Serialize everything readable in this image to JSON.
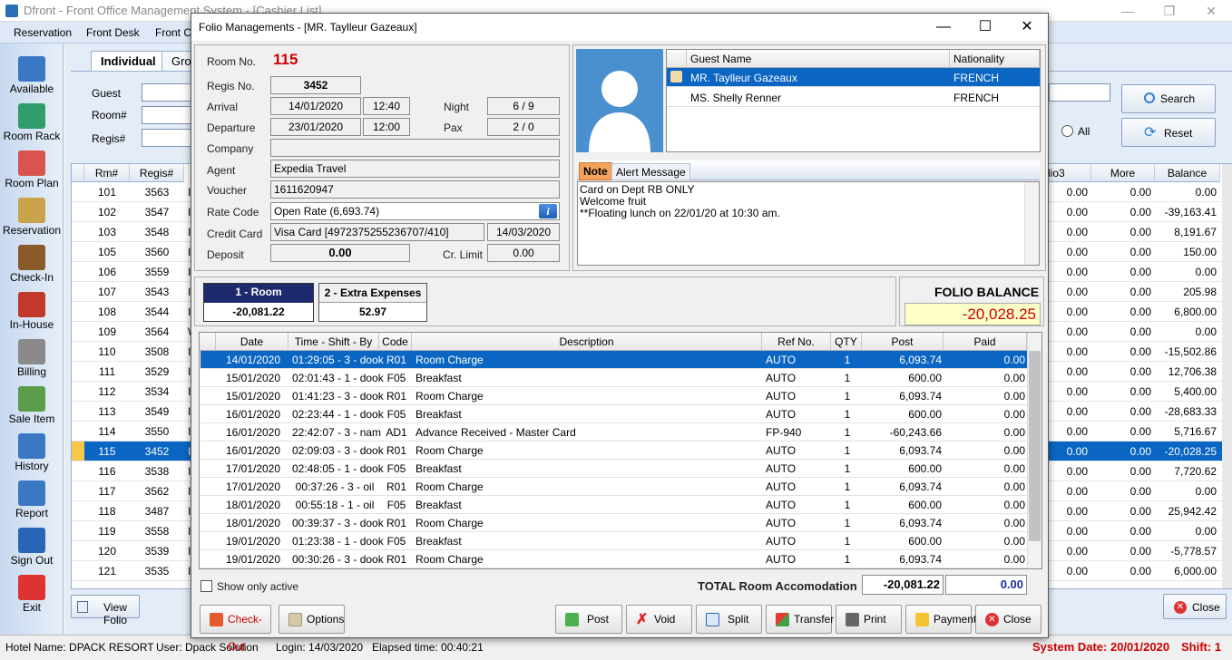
{
  "main_window": {
    "title": "Dfront - Front Office Management System - [Cashier List]",
    "menu": [
      "Reservation",
      "Front Desk",
      "Front C"
    ]
  },
  "sidebar": [
    {
      "label": "Available",
      "icon": "calendar-icon"
    },
    {
      "label": "Room Rack",
      "icon": "room-rack-icon"
    },
    {
      "label": "Room Plan",
      "icon": "room-plan-icon"
    },
    {
      "label": "Reservation",
      "icon": "book-icon"
    },
    {
      "label": "Check-In",
      "icon": "luggage-icon"
    },
    {
      "label": "In-House",
      "icon": "house-icon"
    },
    {
      "label": "Billing",
      "icon": "cash-register-icon"
    },
    {
      "label": "Sale Item",
      "icon": "bottles-icon"
    },
    {
      "label": "History",
      "icon": "history-icon"
    },
    {
      "label": "Report",
      "icon": "report-icon"
    },
    {
      "label": "Sign Out",
      "icon": "sign-out-icon"
    },
    {
      "label": "Exit",
      "icon": "power-icon"
    }
  ],
  "background": {
    "tabs": [
      "Individual",
      "Grou"
    ],
    "labels": {
      "guest": "Guest",
      "room": "Room#",
      "regis": "Regis#"
    },
    "search_button": "Search",
    "reset_button": "Reset",
    "all_radio": "All",
    "view_folio_button": "View Folio",
    "close_button": "Close",
    "grid_headers_left": [
      "Rm#",
      "Regis#"
    ],
    "grid_headers_right": [
      "lio3",
      "More",
      "Balance"
    ],
    "rows": [
      {
        "rm": "101",
        "regis": "3563",
        "c": "I",
        "lio3": "0.00",
        "more": "0.00",
        "balance": "0.00"
      },
      {
        "rm": "102",
        "regis": "3547",
        "c": "I",
        "lio3": "0.00",
        "more": "0.00",
        "balance": "-39,163.41"
      },
      {
        "rm": "103",
        "regis": "3548",
        "c": "I",
        "lio3": "0.00",
        "more": "0.00",
        "balance": "8,191.67"
      },
      {
        "rm": "105",
        "regis": "3560",
        "c": "I",
        "lio3": "0.00",
        "more": "0.00",
        "balance": "150.00"
      },
      {
        "rm": "106",
        "regis": "3559",
        "c": "I",
        "lio3": "0.00",
        "more": "0.00",
        "balance": "0.00"
      },
      {
        "rm": "107",
        "regis": "3543",
        "c": "I",
        "lio3": "0.00",
        "more": "0.00",
        "balance": "205.98"
      },
      {
        "rm": "108",
        "regis": "3544",
        "c": "I",
        "lio3": "0.00",
        "more": "0.00",
        "balance": "6,800.00"
      },
      {
        "rm": "109",
        "regis": "3564",
        "c": "W",
        "lio3": "0.00",
        "more": "0.00",
        "balance": "0.00"
      },
      {
        "rm": "110",
        "regis": "3508",
        "c": "I",
        "lio3": "0.00",
        "more": "0.00",
        "balance": "-15,502.86"
      },
      {
        "rm": "111",
        "regis": "3529",
        "c": "I",
        "lio3": "0.00",
        "more": "0.00",
        "balance": "12,706.38"
      },
      {
        "rm": "112",
        "regis": "3534",
        "c": "I",
        "lio3": "0.00",
        "more": "0.00",
        "balance": "5,400.00"
      },
      {
        "rm": "113",
        "regis": "3549",
        "c": "I",
        "lio3": "0.00",
        "more": "0.00",
        "balance": "-28,683.33"
      },
      {
        "rm": "114",
        "regis": "3550",
        "c": "I",
        "lio3": "0.00",
        "more": "0.00",
        "balance": "5,716.67"
      },
      {
        "rm": "115",
        "regis": "3452",
        "c": "I",
        "lio3": "0.00",
        "more": "0.00",
        "balance": "-20,028.25",
        "selected": true
      },
      {
        "rm": "116",
        "regis": "3538",
        "c": "I",
        "lio3": "0.00",
        "more": "0.00",
        "balance": "7,720.62"
      },
      {
        "rm": "117",
        "regis": "3562",
        "c": "I",
        "lio3": "0.00",
        "more": "0.00",
        "balance": "0.00"
      },
      {
        "rm": "118",
        "regis": "3487",
        "c": "I",
        "lio3": "0.00",
        "more": "0.00",
        "balance": "25,942.42"
      },
      {
        "rm": "119",
        "regis": "3558",
        "c": "IN",
        "lio3": "0.00",
        "more": "0.00",
        "balance": "0.00"
      },
      {
        "rm": "120",
        "regis": "3539",
        "c": "I",
        "lio3": "0.00",
        "more": "0.00",
        "balance": "-5,778.57"
      },
      {
        "rm": "121",
        "regis": "3535",
        "c": "I",
        "lio3": "0.00",
        "more": "0.00",
        "balance": "6,000.00"
      }
    ]
  },
  "status_bar": {
    "hotel": "Hotel Name: DPACK RESORT",
    "user": "User: Dpack Solution",
    "login": "Login: 14/03/2020",
    "elapsed": "Elapsed time: 00:40:21",
    "system_date": "System Date: 20/01/2020",
    "shift": "Shift: 1"
  },
  "dialog": {
    "title": "Folio Managements - [MR. Taylleur Gazeaux]",
    "labels": {
      "room_no": "Room No.",
      "regis_no": "Regis No.",
      "arrival": "Arrival",
      "departure": "Departure",
      "night": "Night",
      "pax": "Pax",
      "company": "Company",
      "agent": "Agent",
      "voucher": "Voucher",
      "rate_code": "Rate Code",
      "credit_card": "Credit Card",
      "deposit": "Deposit",
      "cr_limit": "Cr. Limit"
    },
    "values": {
      "room_no": "115",
      "regis_no": "3452",
      "arrival_date": "14/01/2020",
      "arrival_time": "12:40",
      "departure_date": "23/01/2020",
      "departure_time": "12:00",
      "night": "6 / 9",
      "pax": "2 / 0",
      "company": "",
      "agent": "Expedia Travel",
      "voucher": "1611620947",
      "rate_code": "Open Rate (6,693.74)",
      "credit_card": "Visa Card [4972375255236707/410]",
      "card_expiry": "14/03/2020",
      "deposit": "0.00",
      "cr_limit": "0.00"
    },
    "guests": {
      "headers": [
        "Guest Name",
        "Nationality"
      ],
      "rows": [
        {
          "name": "MR. Taylleur Gazeaux",
          "nationality": "FRENCH",
          "selected": true
        },
        {
          "name": "MS. Shelly Renner",
          "nationality": "FRENCH"
        }
      ]
    },
    "note_tabs": [
      "Note",
      "Alert Message"
    ],
    "note_lines": [
      "Card on Dept RB ONLY",
      "Welcome fruit",
      "**Floating lunch on 22/01/20 at 10:30 am."
    ],
    "folio_tabs": [
      {
        "label": "1 - Room",
        "amount": "-20,081.22",
        "active": true
      },
      {
        "label": "2 - Extra Expenses",
        "amount": "52.97"
      }
    ],
    "folio_balance_label": "FOLIO BALANCE",
    "folio_balance": "-20,028.25",
    "trans_headers": [
      "Date",
      "Time - Shift - By",
      "Code",
      "Description",
      "Ref No.",
      "QTY",
      "Post",
      "Paid"
    ],
    "transactions": [
      {
        "date": "14/01/2020",
        "time": "01:29:05 - 3 - dook",
        "code": "R01",
        "desc": "Room Charge",
        "ref": "AUTO",
        "qty": "1",
        "post": "6,093.74",
        "paid": "0.00",
        "selected": true
      },
      {
        "date": "15/01/2020",
        "time": "02:01:43 - 1 - dook",
        "code": "F05",
        "desc": "Breakfast",
        "ref": "AUTO",
        "qty": "1",
        "post": "600.00",
        "paid": "0.00"
      },
      {
        "date": "15/01/2020",
        "time": "01:41:23 - 3 - dook",
        "code": "R01",
        "desc": "Room Charge",
        "ref": "AUTO",
        "qty": "1",
        "post": "6,093.74",
        "paid": "0.00"
      },
      {
        "date": "16/01/2020",
        "time": "02:23:44 - 1 - dook",
        "code": "F05",
        "desc": "Breakfast",
        "ref": "AUTO",
        "qty": "1",
        "post": "600.00",
        "paid": "0.00"
      },
      {
        "date": "16/01/2020",
        "time": "22:42:07 - 3 - nam",
        "code": "AD1",
        "desc": "Advance Received - Master Card",
        "ref": "FP-940",
        "qty": "1",
        "post": "-60,243.66",
        "paid": "0.00"
      },
      {
        "date": "16/01/2020",
        "time": "02:09:03 - 3 - dook",
        "code": "R01",
        "desc": "Room Charge",
        "ref": "AUTO",
        "qty": "1",
        "post": "6,093.74",
        "paid": "0.00"
      },
      {
        "date": "17/01/2020",
        "time": "02:48:05 - 1 - dook",
        "code": "F05",
        "desc": "Breakfast",
        "ref": "AUTO",
        "qty": "1",
        "post": "600.00",
        "paid": "0.00"
      },
      {
        "date": "17/01/2020",
        "time": "00:37:26 - 3 - oil",
        "code": "R01",
        "desc": "Room Charge",
        "ref": "AUTO",
        "qty": "1",
        "post": "6,093.74",
        "paid": "0.00"
      },
      {
        "date": "18/01/2020",
        "time": "00:55:18 - 1 - oil",
        "code": "F05",
        "desc": "Breakfast",
        "ref": "AUTO",
        "qty": "1",
        "post": "600.00",
        "paid": "0.00"
      },
      {
        "date": "18/01/2020",
        "time": "00:39:37 - 3 - dook",
        "code": "R01",
        "desc": "Room Charge",
        "ref": "AUTO",
        "qty": "1",
        "post": "6,093.74",
        "paid": "0.00"
      },
      {
        "date": "19/01/2020",
        "time": "01:23:38 - 1 - dook",
        "code": "F05",
        "desc": "Breakfast",
        "ref": "AUTO",
        "qty": "1",
        "post": "600.00",
        "paid": "0.00"
      },
      {
        "date": "19/01/2020",
        "time": "00:30:26 - 3 - dook",
        "code": "R01",
        "desc": "Room Charge",
        "ref": "AUTO",
        "qty": "1",
        "post": "6,093.74",
        "paid": "0.00"
      }
    ],
    "show_only_active": "Show only active",
    "total_label": "TOTAL Room Accomodation",
    "total_post": "-20,081.22",
    "total_paid": "0.00",
    "buttons": {
      "checkout": "Check-Out",
      "options": "Options",
      "post": "Post",
      "void": "Void",
      "split": "Split",
      "transfer": "Transfer",
      "print": "Print",
      "payment": "Payment",
      "close": "Close"
    }
  }
}
